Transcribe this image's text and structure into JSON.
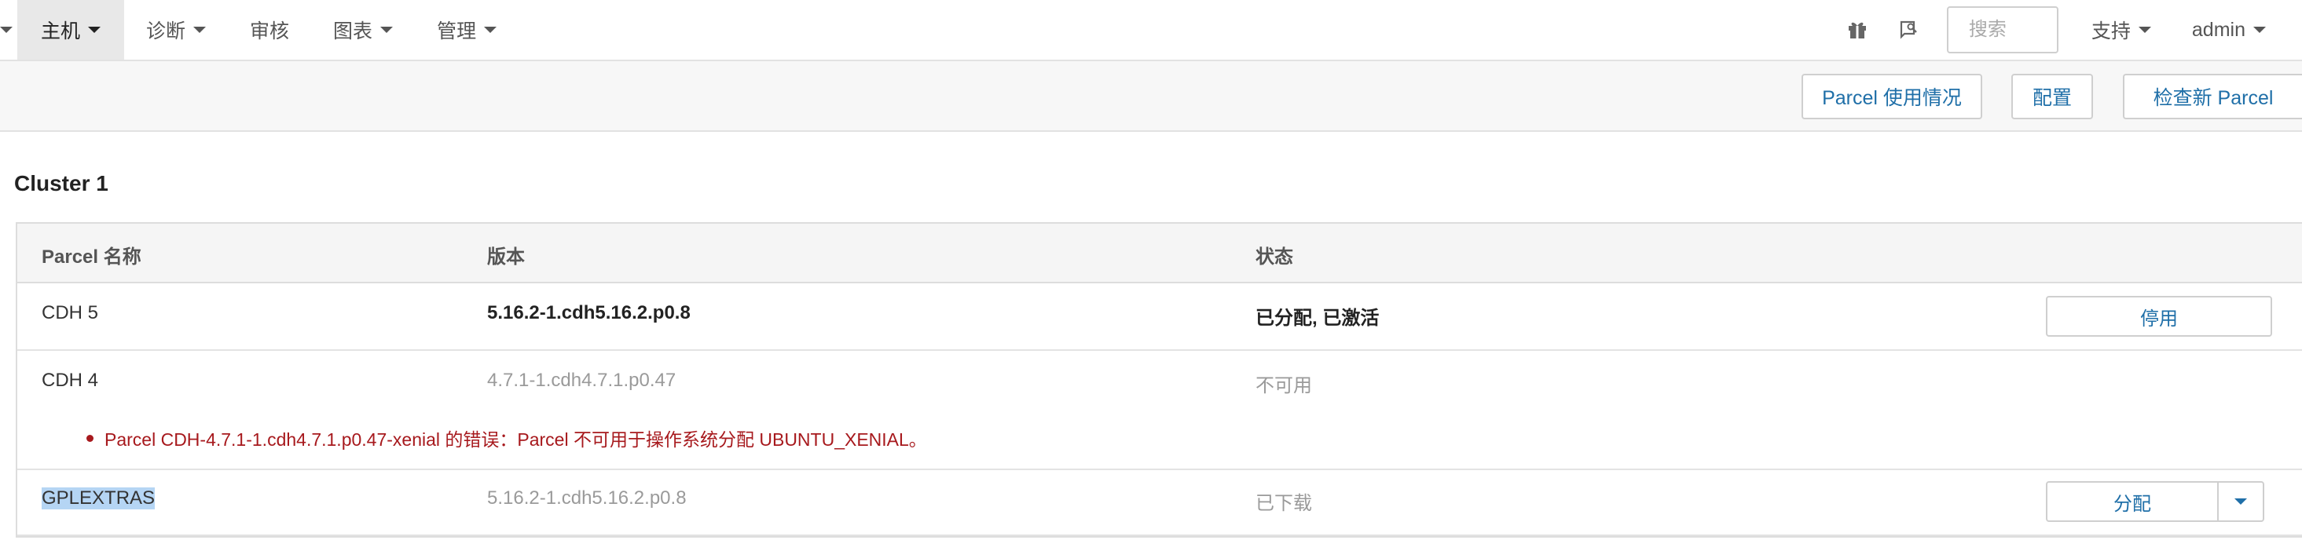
{
  "navbar": {
    "items": [
      {
        "label": "主机",
        "active": true
      },
      {
        "label": "诊断",
        "active": false
      },
      {
        "label": "审核",
        "active": false
      },
      {
        "label": "图表",
        "active": false
      },
      {
        "label": "管理",
        "active": false
      }
    ],
    "icons": [
      "gift-icon",
      "feedback-icon"
    ],
    "search_placeholder": "搜索",
    "support_label": "支持",
    "user_label": "admin"
  },
  "toolbar": {
    "parcel_usage_label": "Parcel 使用情况",
    "config_label": "配置",
    "check_new_label": "检查新 Parcel"
  },
  "cluster": {
    "title": "Cluster 1",
    "columns": [
      "Parcel 名称",
      "版本",
      "状态"
    ],
    "rows": [
      {
        "name": "CDH 5",
        "version": "5.16.2-1.cdh5.16.2.p0.8",
        "status": "已分配, 已激活",
        "action": "停用"
      },
      {
        "name": "CDH 4",
        "version": "4.7.1-1.cdh4.7.1.p0.47",
        "status": "不可用",
        "error": "Parcel CDH-4.7.1-1.cdh4.7.1.p0.47-xenial 的错误：Parcel 不可用于操作系统分配 UBUNTU_XENIAL。"
      },
      {
        "name": "GPLEXTRAS",
        "version": "5.16.2-1.cdh5.16.2.p0.8",
        "status": "已下载",
        "action": "分配"
      }
    ]
  },
  "colors": {
    "link_blue": "#1f6fa8",
    "error_red": "#a7191d",
    "selection_highlight": "#b5d5f4"
  }
}
